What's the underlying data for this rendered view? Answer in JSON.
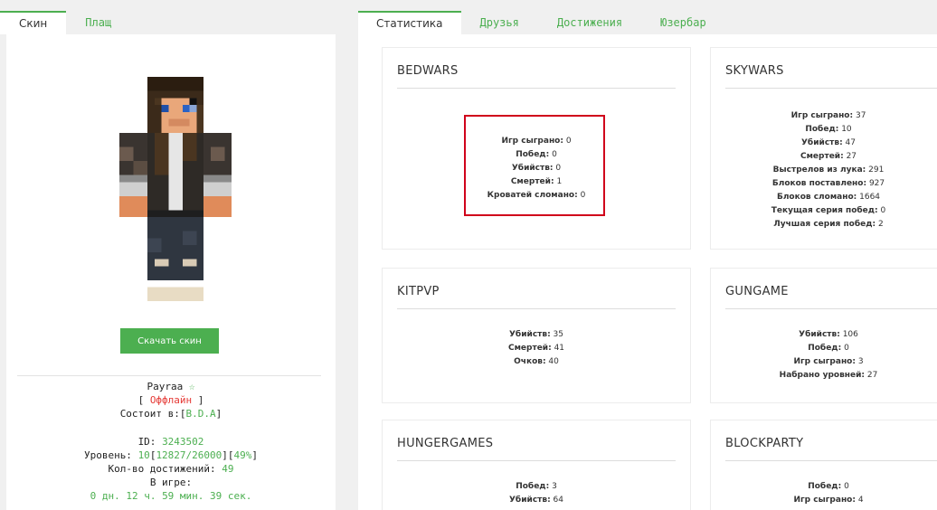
{
  "left_tabs": [
    {
      "label": "Скин",
      "active": true
    },
    {
      "label": "Плащ",
      "active": false
    }
  ],
  "download_button": "Скачать скин",
  "profile": {
    "name": "Payraa",
    "star": "☆",
    "status": "Оффлайн",
    "clan_label": "Состоит в:",
    "clan": "B.D.A",
    "id_label": "ID:",
    "id": "3243502",
    "level_label": "Уровень:",
    "level": "10",
    "xp": "12827/26000",
    "xp_percent": "49%",
    "achievements_label": "Кол-во достижений:",
    "achievements": "49",
    "playtime_label": "В игре:",
    "playtime": "0 дн. 12 ч. 59 мин. 39 сек."
  },
  "right_tabs": [
    {
      "label": "Статистика",
      "active": true
    },
    {
      "label": "Друзья",
      "active": false
    },
    {
      "label": "Достижения",
      "active": false
    },
    {
      "label": "Юзербар",
      "active": false
    }
  ],
  "cards": [
    {
      "title": "BEDWARS",
      "stats": [
        {
          "label": "Игр сыграно:",
          "value": "0"
        },
        {
          "label": "Побед:",
          "value": "0"
        },
        {
          "label": "Убийств:",
          "value": "0"
        },
        {
          "label": "Смертей:",
          "value": "1"
        },
        {
          "label": "Кроватей сломано:",
          "value": "0"
        }
      ]
    },
    {
      "title": "SKYWARS",
      "stats": [
        {
          "label": "Игр сыграно:",
          "value": "37"
        },
        {
          "label": "Побед:",
          "value": "10"
        },
        {
          "label": "Убийств:",
          "value": "47"
        },
        {
          "label": "Смертей:",
          "value": "27"
        },
        {
          "label": "Выстрелов из лука:",
          "value": "291"
        },
        {
          "label": "Блоков поставлено:",
          "value": "927"
        },
        {
          "label": "Блоков сломано:",
          "value": "1664"
        },
        {
          "label": "Текущая серия побед:",
          "value": "0"
        },
        {
          "label": "Лучшая серия побед:",
          "value": "2"
        }
      ]
    },
    {
      "title": "KITPVP",
      "stats": [
        {
          "label": "Убийств:",
          "value": "35"
        },
        {
          "label": "Смертей:",
          "value": "41"
        },
        {
          "label": "Очков:",
          "value": "40"
        }
      ]
    },
    {
      "title": "GUNGAME",
      "stats": [
        {
          "label": "Убийств:",
          "value": "106"
        },
        {
          "label": "Побед:",
          "value": "0"
        },
        {
          "label": "Игр сыграно:",
          "value": "3"
        },
        {
          "label": "Набрано уровней:",
          "value": "27"
        }
      ]
    },
    {
      "title": "HUNGERGAMES",
      "stats": [
        {
          "label": "Побед:",
          "value": "3"
        },
        {
          "label": "Убийств:",
          "value": "64"
        }
      ]
    },
    {
      "title": "BLOCKPARTY",
      "stats": [
        {
          "label": "Побед:",
          "value": "0"
        },
        {
          "label": "Игр сыграно:",
          "value": "4"
        }
      ]
    }
  ],
  "colors": {
    "accent": "#4caf50",
    "offline": "#e53935",
    "highlight": "#d0021b"
  }
}
